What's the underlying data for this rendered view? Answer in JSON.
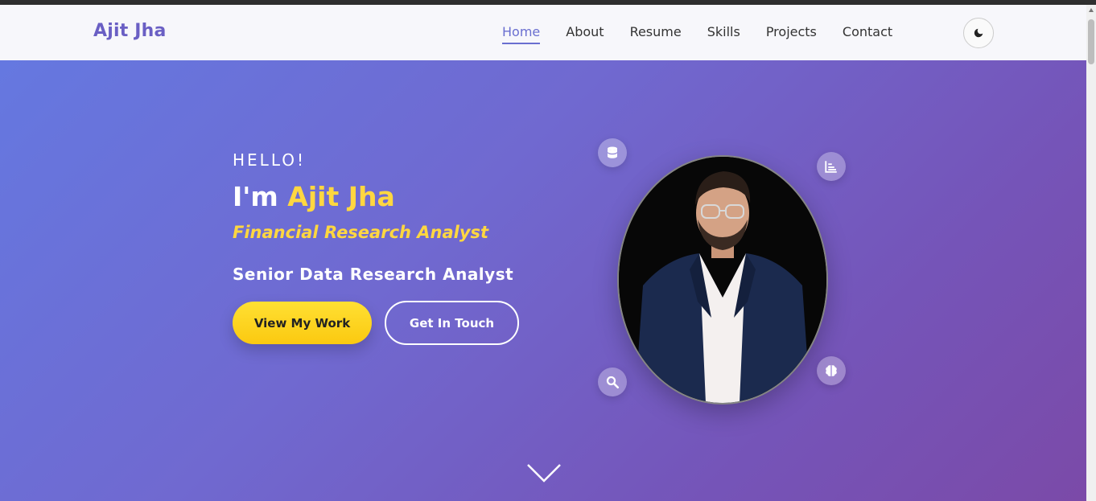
{
  "brand": "Ajit Jha",
  "nav": {
    "items": [
      {
        "label": "Home",
        "active": true
      },
      {
        "label": "About"
      },
      {
        "label": "Resume"
      },
      {
        "label": "Skills"
      },
      {
        "label": "Projects"
      },
      {
        "label": "Contact"
      }
    ],
    "theme_icon": "moon-icon"
  },
  "hero": {
    "greeting": "HELLO!",
    "intro": "I'm",
    "name": "Ajit Jha",
    "role_primary": "Financial Research Analyst",
    "role_secondary": "Senior Data Research Analyst",
    "primary_button": "View My Work",
    "secondary_button": "Get In Touch",
    "floating_icons": [
      "database-icon",
      "chart-icon",
      "search-icon",
      "brain-icon"
    ],
    "scroll_icon": "chevron-down-icon"
  },
  "colors": {
    "accent": "#ffd740",
    "brand": "#6a5fc4",
    "nav_active": "#6a6fd0",
    "hero_start": "#6578e0",
    "hero_end": "#7b4aa8"
  }
}
